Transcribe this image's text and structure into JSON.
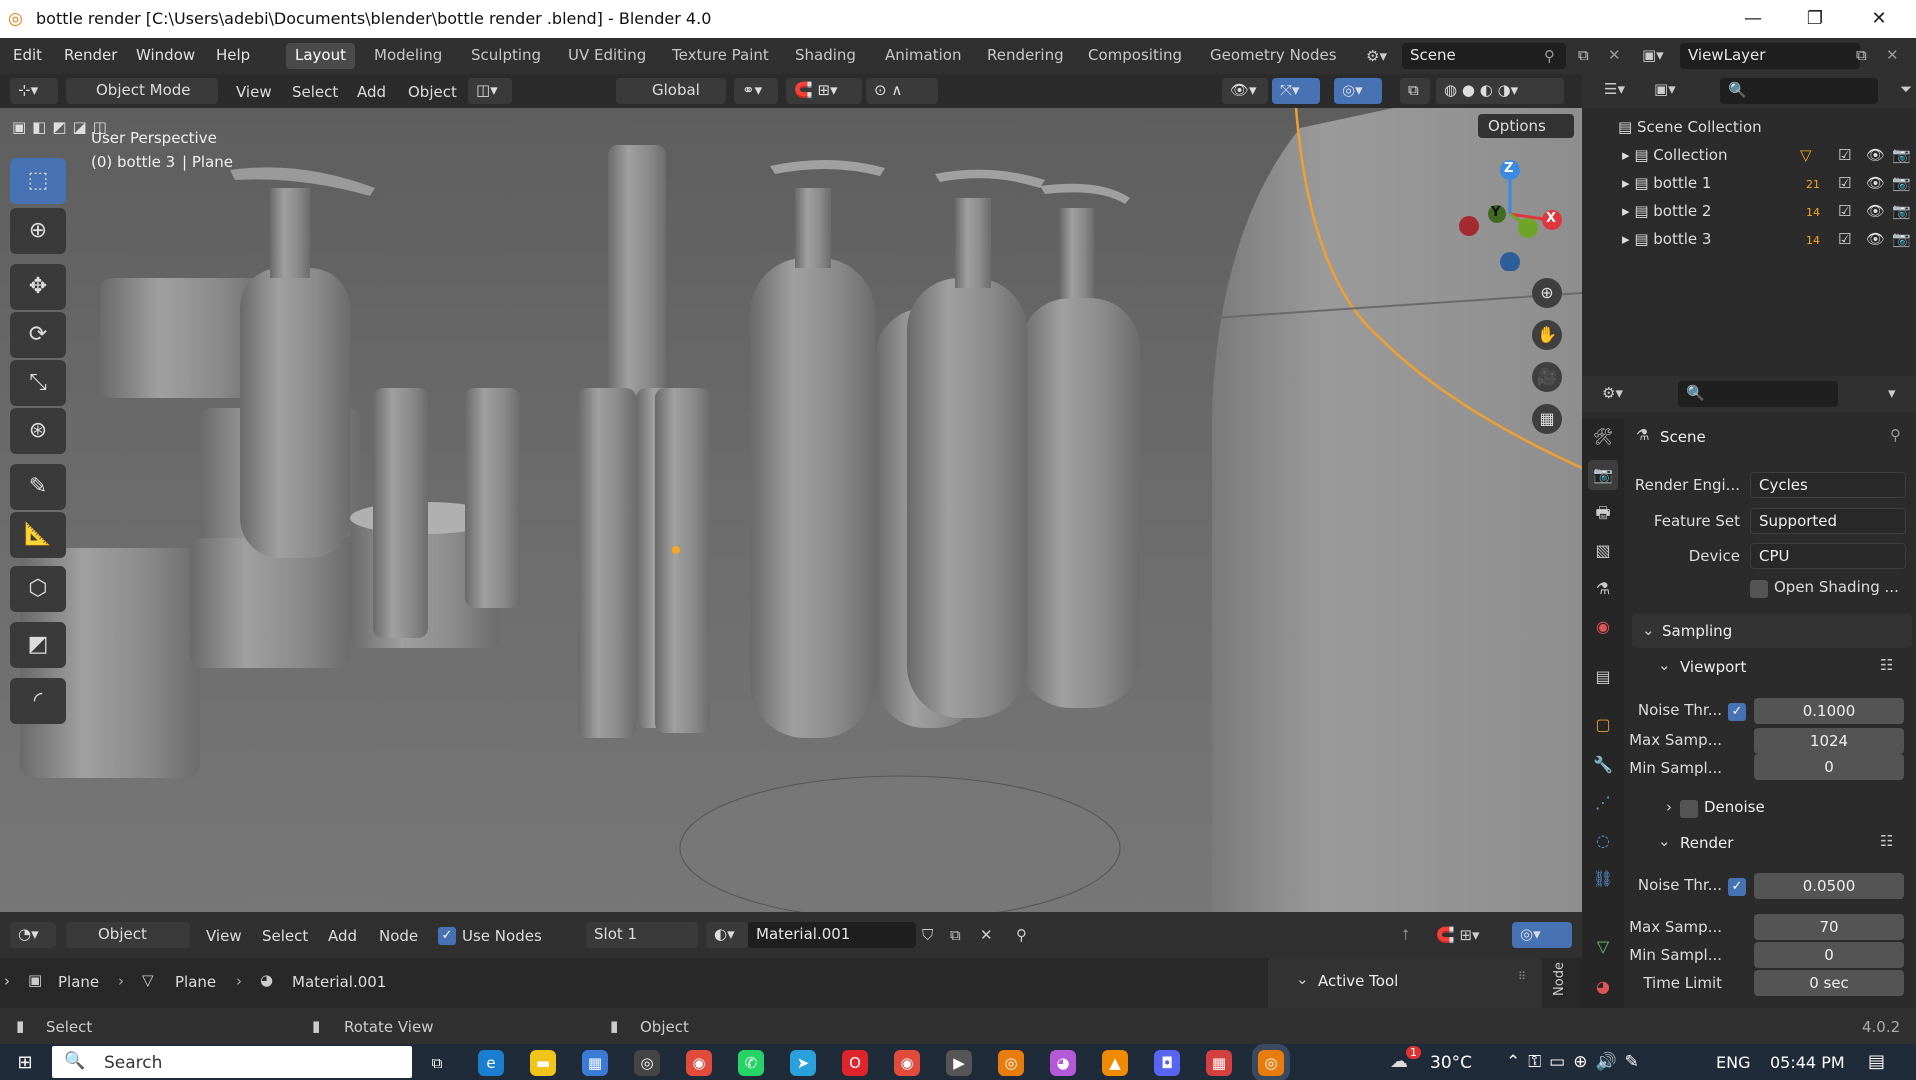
{
  "window": {
    "title": "bottle render  [C:\\Users\\adebi\\Documents\\blender\\bottle render .blend] - Blender 4.0",
    "minimize": "—",
    "restore": "❐",
    "close": "✕"
  },
  "menu": {
    "items": [
      "Edit",
      "Render",
      "Window",
      "Help"
    ]
  },
  "workspaces": {
    "tabs": [
      "Layout",
      "Modeling",
      "Sculpting",
      "UV Editing",
      "Texture Paint",
      "Shading",
      "Animation",
      "Rendering",
      "Compositing",
      "Geometry Nodes"
    ],
    "active": "Layout"
  },
  "scene": {
    "name": "Scene",
    "view_layer": "ViewLayer"
  },
  "viewport_header": {
    "mode": "Object Mode",
    "view": "View",
    "select": "Select",
    "add": "Add",
    "object": "Object",
    "transform": "Global",
    "options": "Options"
  },
  "viewport": {
    "perspective": "User Perspective",
    "active_object": "(0) bottle 3",
    "active_object_sub": "| Plane"
  },
  "gizmo": {
    "z": "Z",
    "y": "Y",
    "x": "X"
  },
  "outliner": {
    "root": "Scene Collection",
    "rows": [
      {
        "name": "Collection",
        "badge": ""
      },
      {
        "name": "bottle 1",
        "badge": "21"
      },
      {
        "name": "bottle 2",
        "badge": "14"
      },
      {
        "name": "bottle 3",
        "badge": "14"
      }
    ]
  },
  "properties": {
    "context": "Scene",
    "render_engine_label": "Render Engi...",
    "render_engine": "Cycles",
    "feature_set_label": "Feature Set",
    "feature_set": "Supported",
    "device_label": "Device",
    "device": "CPU",
    "open_shading": "Open Shading ...",
    "sampling": "Sampling",
    "viewport_panel": "Viewport",
    "vp_noise_label": "Noise Thr...",
    "vp_noise": "0.1000",
    "vp_max_label": "Max Samp...",
    "vp_max": "1024",
    "vp_min_label": "Min Sampl...",
    "vp_min": "0",
    "denoise": "Denoise",
    "render_panel": "Render",
    "r_noise_label": "Noise Thr...",
    "r_noise": "0.0500",
    "r_max_label": "Max Samp...",
    "r_max": "70",
    "r_min_label": "Min Sampl...",
    "r_min": "0",
    "time_limit_label": "Time Limit",
    "time_limit": "0 sec"
  },
  "node_header": {
    "object": "Object",
    "view": "View",
    "select": "Select",
    "add": "Add",
    "node": "Node",
    "use_nodes": "Use Nodes",
    "slot": "Slot 1",
    "material": "Material.001"
  },
  "breadcrumb": {
    "a": "Plane",
    "b": "Plane",
    "c": "Material.001"
  },
  "active_tool": {
    "label": "Active Tool",
    "node_tab": "Node"
  },
  "status": {
    "select": "Select",
    "rotate": "Rotate View",
    "object": "Object",
    "version": "4.0.2"
  },
  "taskbar": {
    "search": "Search",
    "temp": "30°C",
    "lang": "ENG",
    "time": "05:44 PM",
    "weather_badge": "1"
  },
  "colors": {
    "accent": "#4772b3",
    "selection": "#f5a623",
    "x_axis": "#e2363f",
    "y_axis": "#6fa526",
    "z_axis": "#3b8be0"
  }
}
